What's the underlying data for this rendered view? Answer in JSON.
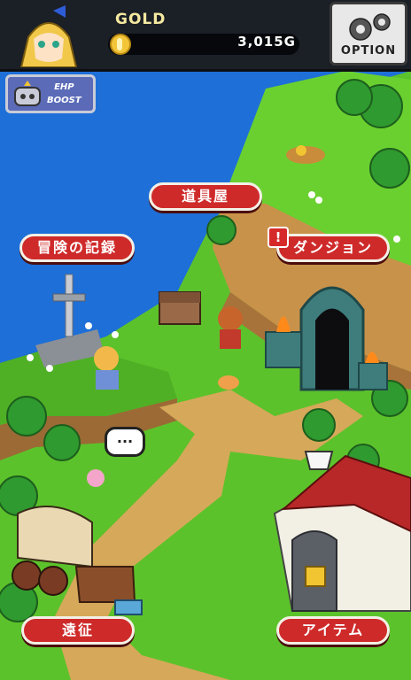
{
  "hud": {
    "gold_label": "GOLD",
    "gold_value": "3,015G",
    "option_label": "OPTION",
    "ehp_line1": "EHP",
    "ehp_line2": "BOOST"
  },
  "locations": {
    "shop": "道具屋",
    "records": "冒険の記録",
    "dungeon": "ダンジョン",
    "dungeon_alert": "!",
    "expedition": "遠征",
    "items": "アイテム"
  },
  "npc": {
    "speech": "..."
  },
  "colors": {
    "sky": "#1e6fd8",
    "grass": "#5cc22b",
    "path": "#d6a85a",
    "cliff": "#c9924a",
    "button_red": "#cf2a2a"
  }
}
